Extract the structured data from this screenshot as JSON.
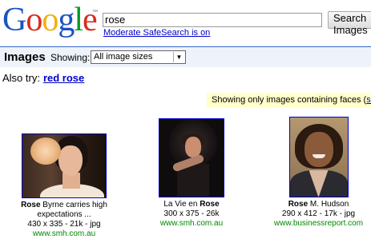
{
  "header": {
    "logo_letters": [
      "G",
      "o",
      "o",
      "g",
      "l",
      "e"
    ],
    "logo_colors": [
      "#1a53c5",
      "#d62d20",
      "#eeb211",
      "#1a53c5",
      "#009925",
      "#d62d20"
    ],
    "trademark": "™",
    "search_value": "rose",
    "search_button": "Search Images",
    "safesearch_link": "Moderate SafeSearch is on"
  },
  "images_bar": {
    "title": "Images",
    "showing_label": "Showing:",
    "size_selected": "All image sizes"
  },
  "also_try": {
    "label": "Also try:",
    "suggestion": "red rose"
  },
  "faces_notice": {
    "text": "Showing only images containing faces (",
    "link_text": "sh"
  },
  "results": [
    {
      "title_bold": "Rose",
      "title_rest": " Byrne carries high",
      "title_line2": "expectations ...",
      "meta": "430 x 335 - 21k - jpg",
      "domain": "www.smh.com.au"
    },
    {
      "title_pre": "La Vie en ",
      "title_bold": "Rose",
      "meta": "300 x 375 - 26k",
      "domain": "www.smh.com.au"
    },
    {
      "title_bold": "Rose",
      "title_rest": " M. Hudson",
      "meta": "290 x 412 - 17k - jpg",
      "domain": "www.businessreport.com"
    }
  ],
  "colors": {
    "link": "#0000cc",
    "domain_green": "#008000",
    "bar_background": "#eef3fb",
    "bar_border": "#3366cc",
    "faces_background": "#ffffc9"
  }
}
